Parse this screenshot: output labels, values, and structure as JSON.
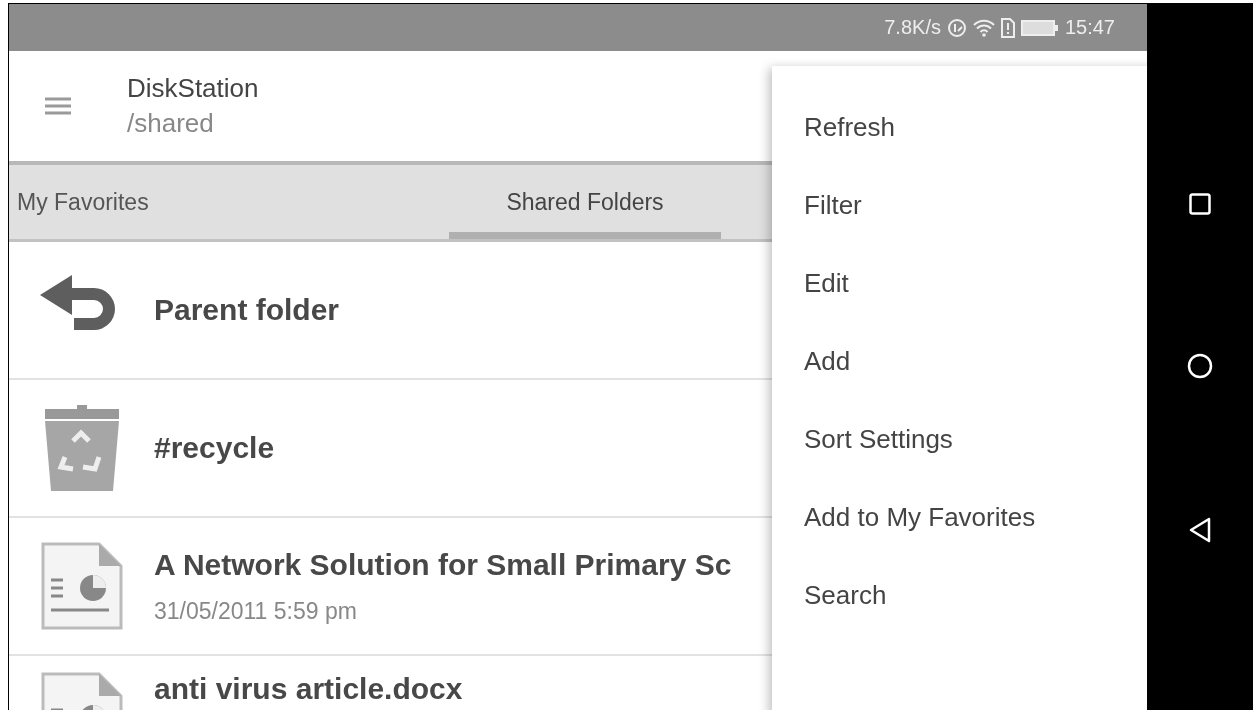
{
  "status_bar": {
    "speed": "7.8K/s",
    "time": "15:47"
  },
  "app_bar": {
    "title": "DiskStation",
    "subtitle": "/shared"
  },
  "tabs": [
    {
      "label": "My Favorites",
      "selected": false
    },
    {
      "label": "Shared Folders",
      "selected": true
    }
  ],
  "files": [
    {
      "kind": "parent",
      "name": "Parent folder"
    },
    {
      "kind": "recycle",
      "name": "#recycle"
    },
    {
      "kind": "document",
      "name": "A Network Solution for Small Primary Sc",
      "date": "31/05/2011 5:59 pm"
    },
    {
      "kind": "document",
      "name": "anti virus article.docx"
    }
  ],
  "menu": [
    "Refresh",
    "Filter",
    "Edit",
    "Add",
    "Sort Settings",
    "Add to My Favorites",
    "Search"
  ]
}
